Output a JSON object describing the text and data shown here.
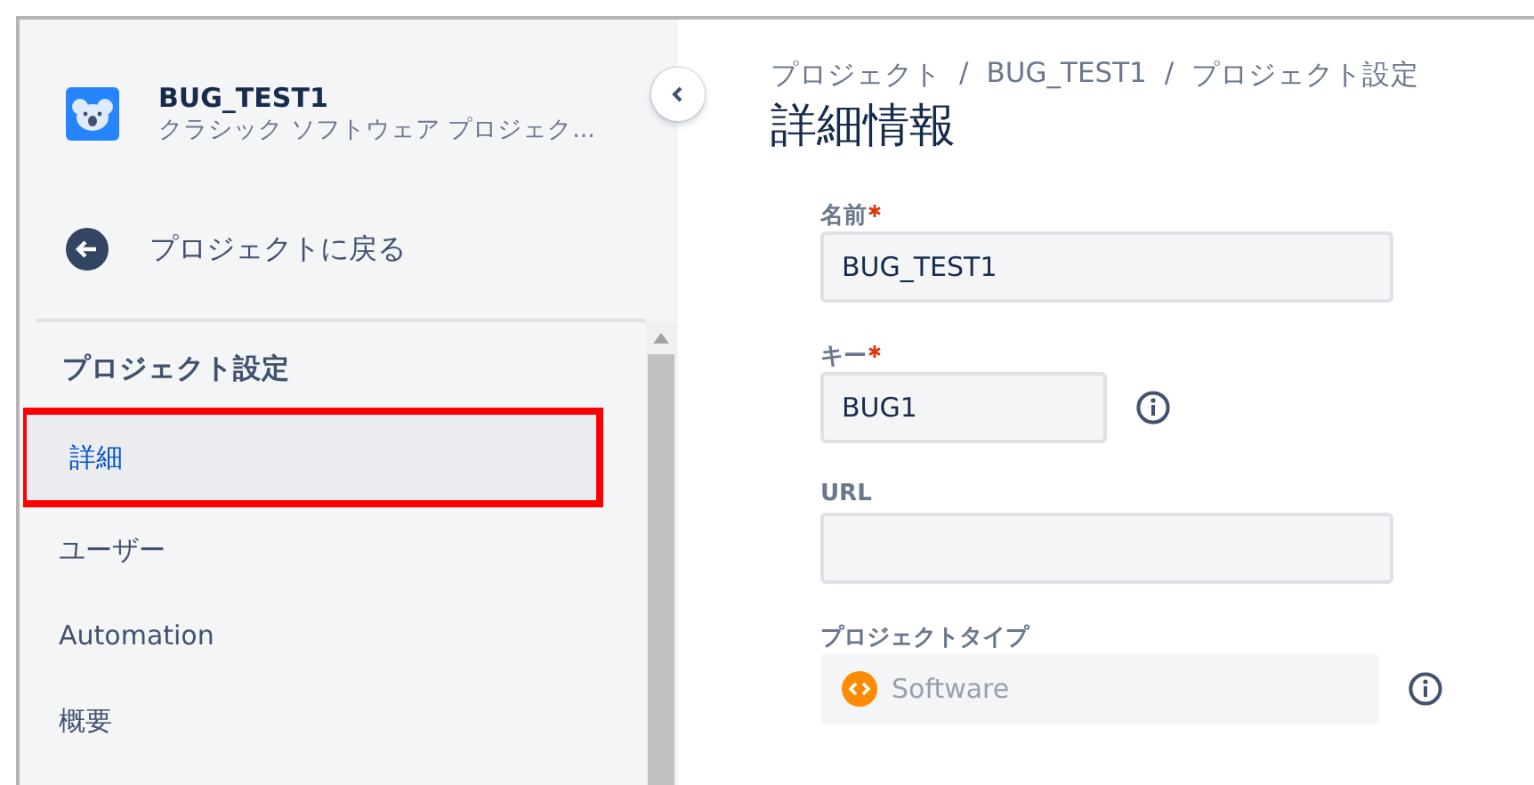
{
  "sidebar": {
    "project": {
      "name": "BUG_TEST1",
      "type": "クラシック ソフトウェア プロジェク..."
    },
    "back_link": "プロジェクトに戻る",
    "section_title": "プロジェクト設定",
    "items": [
      {
        "label": "詳細",
        "selected": true,
        "highlighted": true
      },
      {
        "label": "ユーザー",
        "selected": false,
        "highlighted": false
      },
      {
        "label": "Automation",
        "selected": false,
        "highlighted": false
      },
      {
        "label": "概要",
        "selected": false,
        "highlighted": false
      }
    ]
  },
  "breadcrumbs": [
    {
      "kind": "link",
      "text": "プロジェクト"
    },
    {
      "kind": "separator",
      "text": "/"
    },
    {
      "kind": "link",
      "text": "BUG_TEST1"
    },
    {
      "kind": "separator",
      "text": "/"
    },
    {
      "kind": "link",
      "text": "プロジェクト設定"
    }
  ],
  "page_title": "詳細情報",
  "fields": [
    {
      "kind": "text",
      "label": "名前",
      "required": true,
      "value": "BUG_TEST1",
      "info": false,
      "disabled": false
    },
    {
      "kind": "short",
      "label": "キー",
      "required": true,
      "value": "BUG1",
      "info": true,
      "disabled": false
    },
    {
      "kind": "text",
      "label": "URL",
      "required": false,
      "info": false,
      "disabled": false
    },
    {
      "kind": "type",
      "label": "プロジェクトタイプ",
      "required": false,
      "value": "Software",
      "info": true,
      "disabled": true
    }
  ]
}
